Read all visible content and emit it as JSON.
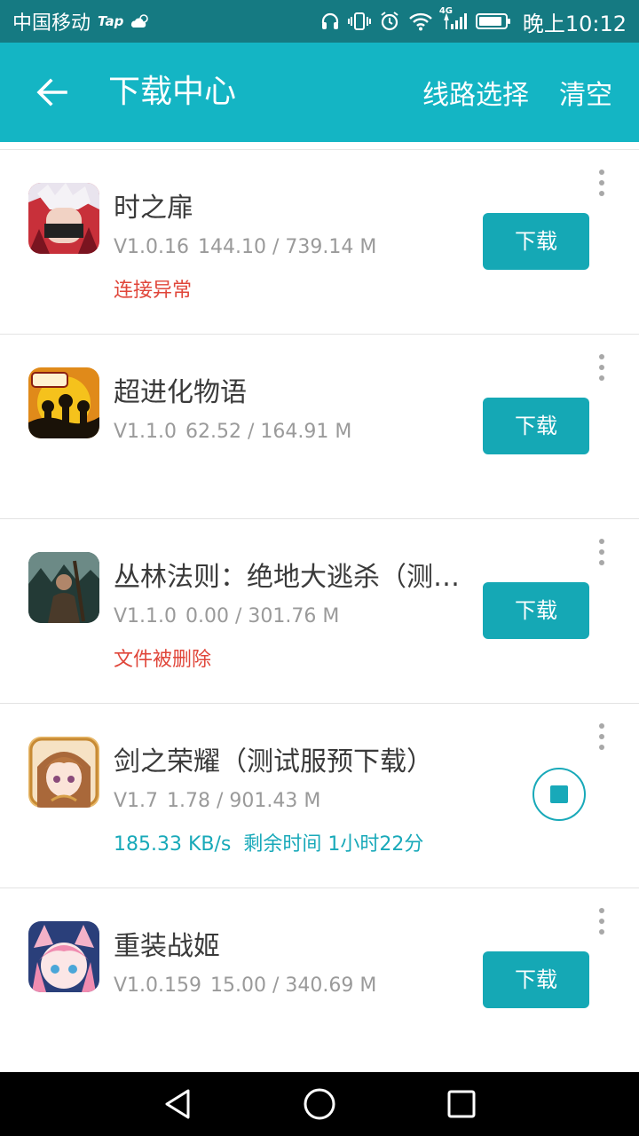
{
  "status_bar": {
    "carrier": "中国移动",
    "tap": "Tap",
    "time": "晚上10:12",
    "network": "4G",
    "icons": [
      "weather-icon",
      "headset-icon",
      "vibrate-icon",
      "alarm-icon",
      "wifi-icon",
      "signal-icon",
      "battery-icon"
    ]
  },
  "toolbar": {
    "title": "下载中心",
    "route_label": "线路选择",
    "clear_label": "清空",
    "background": "#14b5c4"
  },
  "items": [
    {
      "name": "时之扉",
      "version": "V1.0.16",
      "progress": "144.10 / 739.14 M",
      "status": "连接异常",
      "status_type": "error",
      "action": "下载"
    },
    {
      "name": "超进化物语",
      "version": "V1.1.0",
      "progress": "62.52 / 164.91 M",
      "status": "",
      "status_type": "none",
      "action": "下载"
    },
    {
      "name": "丛林法则：绝地大逃杀（测…",
      "version": "V1.1.0",
      "progress": "0.00 / 301.76 M",
      "status": "文件被删除",
      "status_type": "error",
      "action": "下载"
    },
    {
      "name": "剑之荣耀（测试服预下载）",
      "version": "V1.7",
      "progress": "1.78 / 901.43 M",
      "status": "185.33 KB/s  剩余时间 1小时22分",
      "status_type": "downloading",
      "action": "stop"
    },
    {
      "name": "重装战姬",
      "version": "V1.0.159",
      "progress": "15.00 / 340.69 M",
      "status": "",
      "status_type": "none",
      "action": "下载"
    }
  ],
  "colors": {
    "accent": "#15a8b5",
    "error": "#e0463a",
    "downloading": "#18a9b9",
    "status_bar": "#157a82"
  },
  "navbar": {
    "icons": [
      "back-triangle-icon",
      "home-circle-icon",
      "recents-square-icon"
    ]
  }
}
